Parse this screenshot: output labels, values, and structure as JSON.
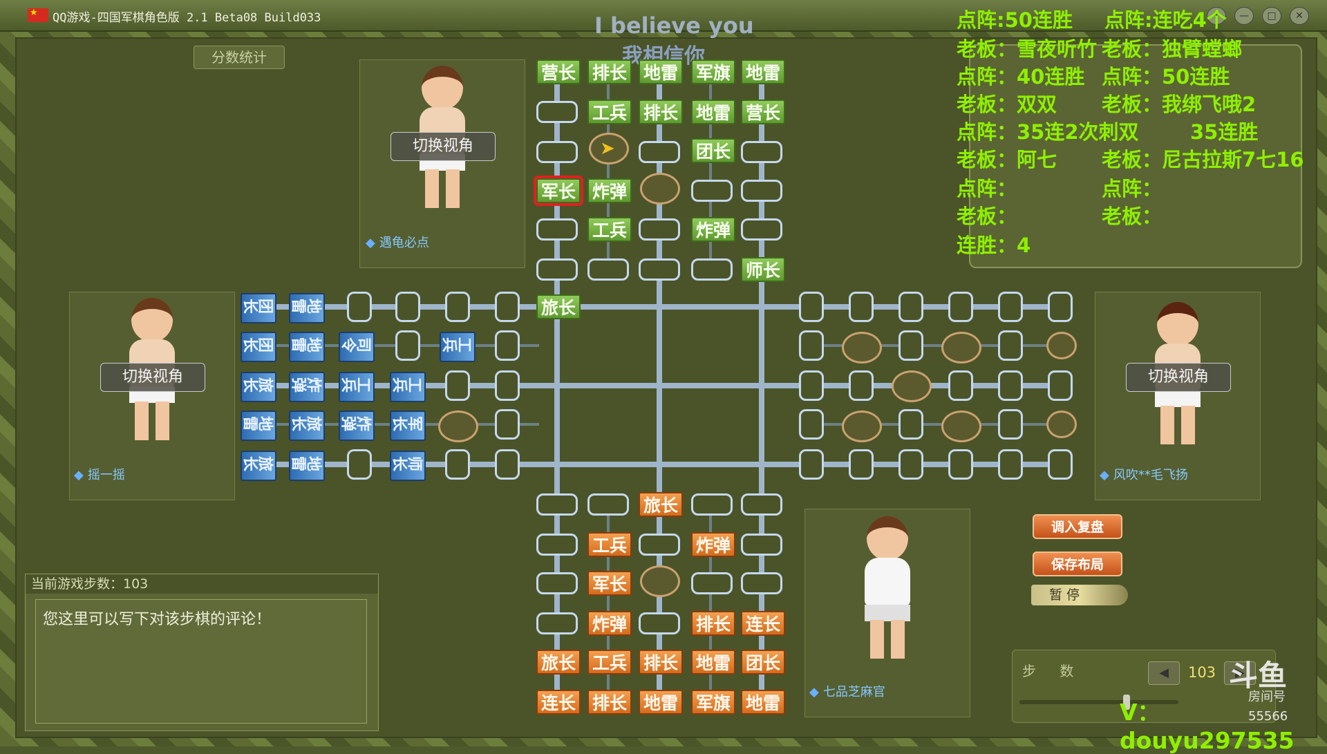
{
  "window": {
    "title": "QQ游戏-四国军棋角色版 2.1 Beta08 Build033",
    "controls": [
      "?",
      "—",
      "□",
      "✕"
    ]
  },
  "header": {
    "score_stats_label": "分数统计",
    "overlay_text": "I believe you",
    "overlay_subtext": "我相信你"
  },
  "players": {
    "top": {
      "name": "遇龟必点",
      "switch_label": "切换视角"
    },
    "left": {
      "name": "摇一摇",
      "switch_label": "切换视角"
    },
    "right": {
      "name": "风吹**毛飞扬",
      "switch_label": "切换视角"
    },
    "bottom": {
      "name": "七品芝麻官"
    }
  },
  "board": {
    "top_green": [
      [
        "营长",
        "排长",
        "地雷",
        "军旗",
        "地雷"
      ],
      [
        "",
        "工兵",
        "排长",
        "地雷",
        "营长"
      ],
      [
        "",
        "",
        "",
        "团长",
        ""
      ],
      [
        "军长",
        "炸弹",
        "",
        "",
        ""
      ],
      [
        "",
        "工兵",
        "",
        "炸弹",
        ""
      ],
      [
        "",
        "",
        "",
        "",
        "师长"
      ]
    ],
    "center_green": "旅长",
    "bottom_orange": [
      [
        "",
        "",
        "旅长",
        "",
        ""
      ],
      [
        "",
        "工兵",
        "",
        "炸弹",
        ""
      ],
      [
        "",
        "军长",
        "",
        "",
        ""
      ],
      [
        "",
        "炸弹",
        "",
        "排长",
        "连长"
      ],
      [
        "旅长",
        "工兵",
        "排长",
        "地雷",
        "团长"
      ],
      [
        "连长",
        "排长",
        "地雷",
        "军旗",
        "地雷"
      ]
    ],
    "left_blue": [
      [
        "团长",
        "团长",
        "旅长",
        "地雷",
        "旅长"
      ],
      [
        "地雷",
        "地雷",
        "炸弹",
        "旅长",
        "地雷"
      ],
      [
        "",
        "司令",
        "工兵",
        "炸弹",
        ""
      ],
      [
        "",
        "",
        "工兵",
        "军长",
        "师长"
      ],
      [
        "",
        "工兵",
        "",
        "",
        ""
      ]
    ]
  },
  "comment": {
    "step_label": "当前游戏步数：103",
    "placeholder": "您这里可以写下对该步棋的评论！"
  },
  "actions": {
    "load_replay": "调入复盘",
    "save_layout": "保存布局",
    "pause": "暂 停"
  },
  "steps": {
    "label": "步 数",
    "value": "103",
    "prev": "◀",
    "next": "▶"
  },
  "overlay_info": [
    "点阵:50连胜",
    "点阵:连吃4个",
    "老板：雪夜听竹",
    "老板：独臂螳螂",
    "点阵：40连胜",
    "点阵：50连胜",
    "老板：双双",
    "老板：我绑飞哦2",
    "点阵：35连2次刺双",
    "35连胜",
    "老板：阿七",
    "老板：尼古拉斯7七16",
    "点阵：",
    "点阵：",
    "老板：",
    "老板：",
    "连胜：4"
  ],
  "watermark": {
    "logo": "斗鱼",
    "logo_sub": "房间号",
    "id": "V：douyu297535",
    "number": "55566"
  },
  "colors": {
    "accent_green": "#8ef000",
    "piece_green": "#6eaa3a",
    "piece_orange": "#e07a28",
    "piece_blue": "#3e7cc0",
    "selected_border": "#e02020"
  }
}
